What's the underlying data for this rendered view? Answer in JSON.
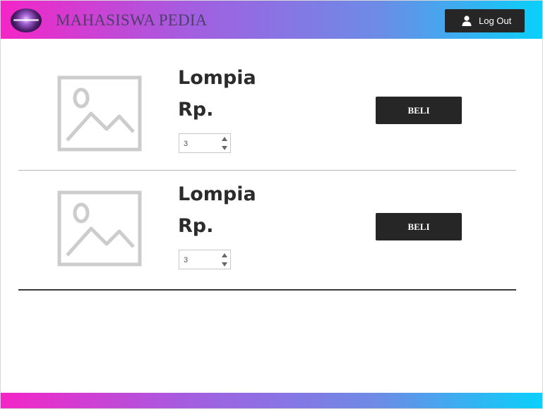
{
  "header": {
    "brand": "MAHASISWA PEDIA",
    "logout_label": "Log Out"
  },
  "products": [
    {
      "name": "Lompia",
      "price": "Rp.",
      "quantity": "3",
      "buy_label": "BELI"
    },
    {
      "name": "Lompia",
      "price": "Rp.",
      "quantity": "3",
      "buy_label": "BELI"
    }
  ],
  "colors": {
    "gradient_start": "#f425c7",
    "gradient_end": "#09d0fb",
    "button_dark": "#262626",
    "placeholder_gray": "#cccccc"
  },
  "icons": [
    "logo-icon",
    "user-icon",
    "image-placeholder-icon",
    "spinner-up-icon",
    "spinner-down-icon"
  ]
}
